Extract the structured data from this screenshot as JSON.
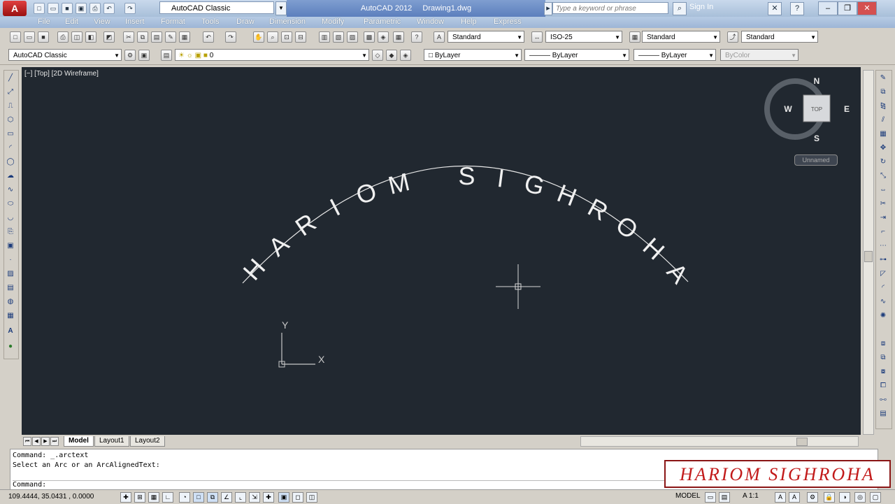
{
  "titlebar": {
    "app_logo": "A",
    "workspace": "AutoCAD Classic",
    "app_name": "AutoCAD 2012",
    "document": "Drawing1.dwg",
    "search_placeholder": "Type a keyword or phrase",
    "sign_in": "Sign In"
  },
  "menu": [
    "File",
    "Edit",
    "View",
    "Insert",
    "Format",
    "Tools",
    "Draw",
    "Dimension",
    "Modify",
    "Parametric",
    "Window",
    "Help",
    "Express"
  ],
  "toolbar1": {
    "text_style": "Standard",
    "dim_style": "ISO-25",
    "table_style": "Standard",
    "mleader_style": "Standard"
  },
  "toolbar2": {
    "workspace": "AutoCAD Classic",
    "layer": "0",
    "color": "ByLayer",
    "linetype": "ByLayer",
    "lineweight": "ByLayer",
    "plotstyle": "ByColor"
  },
  "viewport": {
    "label": "[−] [Top] [2D Wireframe]",
    "arc_text": "HARIOM SIGHROHA",
    "ucs_x": "X",
    "ucs_y": "Y",
    "background": "#212830"
  },
  "viewcube": {
    "north": "N",
    "south": "S",
    "east": "E",
    "west": "W",
    "face": "TOP",
    "ucs_menu": "Unnamed"
  },
  "tabs": [
    "Model",
    "Layout1",
    "Layout2"
  ],
  "command": {
    "line1": "Command:  _.arctext",
    "line2": "Select an Arc or an ArcAlignedText:",
    "prompt": "Command:"
  },
  "status": {
    "coords": "109.4444, 35.0431 , 0.0000",
    "model": "MODEL",
    "scale": "1:1"
  },
  "watermark": "HARIOM SIGHROHA",
  "colors": {
    "canvas": "#212830",
    "accent": "#c21a1a"
  }
}
